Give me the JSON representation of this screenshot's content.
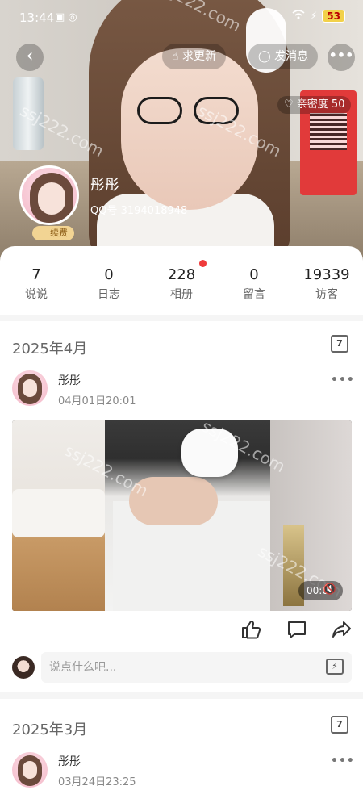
{
  "status_bar": {
    "time": "13:44",
    "battery": "53"
  },
  "top_actions": {
    "back_icon": "chevron-left",
    "request_update": "求更新",
    "send_message": "发消息",
    "more": "•••"
  },
  "intimacy": {
    "label": "亲密度 50"
  },
  "profile": {
    "name": "彤彤",
    "qq": "QQ号 3194018948",
    "renew_badge": "续费"
  },
  "stats": [
    {
      "num": "7",
      "label": "说说"
    },
    {
      "num": "0",
      "label": "日志"
    },
    {
      "num": "228",
      "label": "相册"
    },
    {
      "num": "0",
      "label": "留言"
    },
    {
      "num": "19339",
      "label": "访客"
    }
  ],
  "sections": [
    {
      "month": "2025年4月",
      "calendar": "7",
      "post": {
        "author": "彤彤",
        "date": "04月01日20:01",
        "more": "•••",
        "video_time": "00:00"
      }
    },
    {
      "month": "2025年3月",
      "calendar": "7",
      "post": {
        "author": "彤彤",
        "date": "03月24日23:25",
        "more": "•••"
      }
    }
  ],
  "comment": {
    "placeholder": "说点什么吧..."
  },
  "watermark": "ssj222.com",
  "colors": {
    "accent_red": "#ef3b3b",
    "badge_gold": "#f2d493"
  }
}
